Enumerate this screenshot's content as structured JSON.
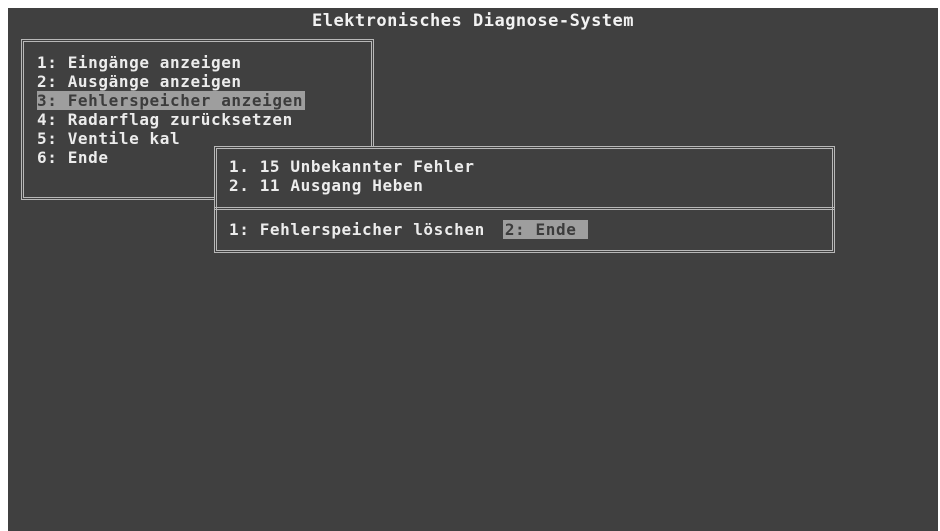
{
  "screen": {
    "title": "Elektronisches Diagnose-System"
  },
  "main_menu": {
    "items": [
      {
        "label": "1: Eingänge anzeigen",
        "selected": false
      },
      {
        "label": "2: Ausgänge anzeigen",
        "selected": false
      },
      {
        "label": "3: Fehlerspeicher anzeigen",
        "selected": true
      },
      {
        "label": "4: Radarflag zurücksetzen",
        "selected": false
      },
      {
        "label": "5: Ventile kal",
        "selected": false
      },
      {
        "label": "6: Ende",
        "selected": false
      }
    ]
  },
  "error_popup": {
    "errors": [
      {
        "label": "1. 15 Unbekannter Fehler"
      },
      {
        "label": "2. 11 Ausgang Heben"
      }
    ],
    "actions": [
      {
        "label": "1: Fehlerspeicher löschen",
        "selected": false
      },
      {
        "label": "2: Ende",
        "selected": true
      }
    ]
  },
  "colors": {
    "background": "#404040",
    "text": "#ececec",
    "highlight": "#9e9e9e",
    "border": "#b8b8b8"
  }
}
